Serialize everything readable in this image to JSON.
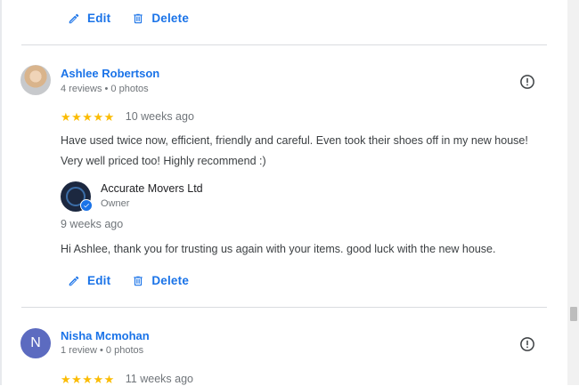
{
  "actions": {
    "edit_label": "Edit",
    "delete_label": "Delete"
  },
  "reviews": [
    {
      "name": "Ashlee Robertson",
      "meta": "4 reviews • 0 photos",
      "stars": "★★★★★",
      "rating": 5,
      "time": "10 weeks ago",
      "text": "Have used twice now, efficient, friendly and careful. Even took their shoes off in my new house! Very well priced too! Highly recommend :)",
      "reply": {
        "owner_name": "Accurate Movers Ltd",
        "owner_role": "Owner",
        "time": "9 weeks ago",
        "text": "Hi Ashlee, thank you for trusting us again with your items. good luck with the new house."
      }
    },
    {
      "avatar_letter": "N",
      "name": "Nisha Mcmohan",
      "meta": "1 review • 0 photos",
      "stars": "★★★★★",
      "rating": 5,
      "time": "11 weeks ago"
    }
  ],
  "colors": {
    "link": "#1a73e8",
    "star": "#fbbc04",
    "avatar_n": "#5c6bc0"
  }
}
